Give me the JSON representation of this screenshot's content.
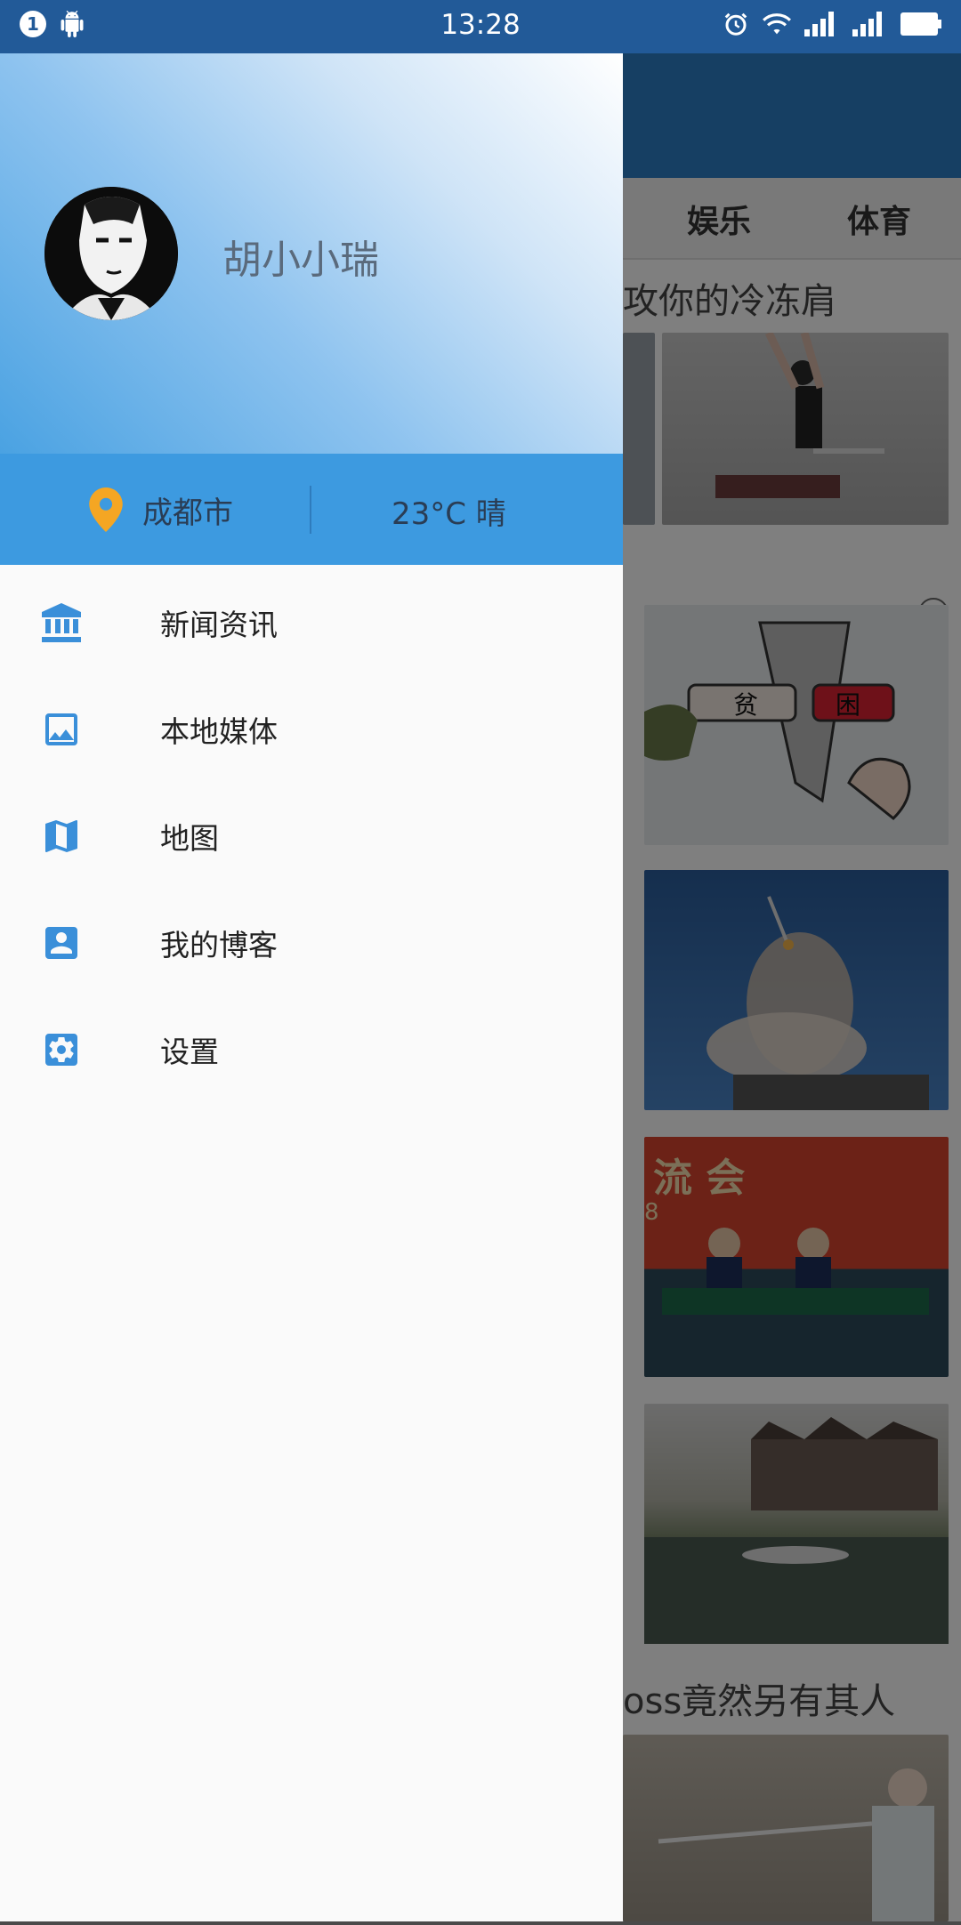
{
  "status_bar": {
    "notification_count": "1",
    "time": "13:28",
    "sim_slot": "2"
  },
  "background_app": {
    "tabs": [
      "娱乐",
      "体育"
    ],
    "headlines": [
      "攻你的冷冻肩",
      "oss竟然另有其人"
    ],
    "image_texts": [
      "贫",
      "困",
      "流  会",
      "8"
    ]
  },
  "drawer": {
    "user_name": "胡小小瑞",
    "city": "成都市",
    "weather": "23°C 晴",
    "menu": [
      {
        "label": "新闻资讯",
        "icon": "bank-icon"
      },
      {
        "label": "本地媒体",
        "icon": "image-icon"
      },
      {
        "label": "地图",
        "icon": "map-icon"
      },
      {
        "label": "我的博客",
        "icon": "account-box-icon"
      },
      {
        "label": "设置",
        "icon": "settings-icon"
      }
    ]
  },
  "colors": {
    "accent": "#3d9ae0",
    "icon_blue": "#3a8fd9",
    "pin_orange": "#f5a623"
  }
}
